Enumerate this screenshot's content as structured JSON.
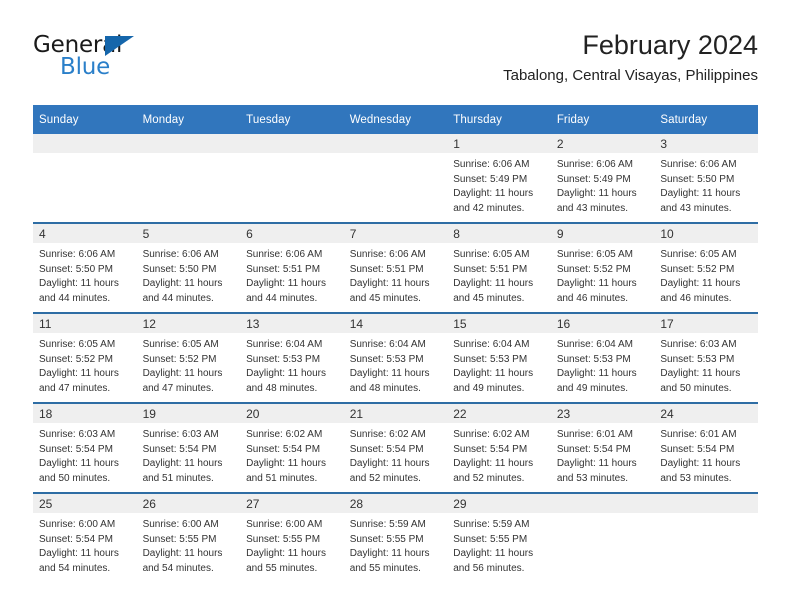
{
  "brand": {
    "word_one": "General",
    "word_two": "Blue",
    "logo_icon": "blue-triangle-icon"
  },
  "header": {
    "title": "February 2024",
    "location": "Tabalong, Central Visayas, Philippines"
  },
  "colors": {
    "header_blue": "#3176bd",
    "row_divider_blue": "#2e6da4",
    "daynum_strip_gray": "#efefef",
    "brand_blue": "#2a7fc9",
    "logo_triangle_blue": "#1566ab",
    "text": "#333333"
  },
  "weekday_headers": [
    "Sunday",
    "Monday",
    "Tuesday",
    "Wednesday",
    "Thursday",
    "Friday",
    "Saturday"
  ],
  "weeks": [
    [
      {
        "day": "",
        "empty": true
      },
      {
        "day": "",
        "empty": true
      },
      {
        "day": "",
        "empty": true
      },
      {
        "day": "",
        "empty": true
      },
      {
        "day": "1",
        "sunrise": "Sunrise: 6:06 AM",
        "sunset": "Sunset: 5:49 PM",
        "daylight": "Daylight: 11 hours and 42 minutes."
      },
      {
        "day": "2",
        "sunrise": "Sunrise: 6:06 AM",
        "sunset": "Sunset: 5:49 PM",
        "daylight": "Daylight: 11 hours and 43 minutes."
      },
      {
        "day": "3",
        "sunrise": "Sunrise: 6:06 AM",
        "sunset": "Sunset: 5:50 PM",
        "daylight": "Daylight: 11 hours and 43 minutes."
      }
    ],
    [
      {
        "day": "4",
        "sunrise": "Sunrise: 6:06 AM",
        "sunset": "Sunset: 5:50 PM",
        "daylight": "Daylight: 11 hours and 44 minutes."
      },
      {
        "day": "5",
        "sunrise": "Sunrise: 6:06 AM",
        "sunset": "Sunset: 5:50 PM",
        "daylight": "Daylight: 11 hours and 44 minutes."
      },
      {
        "day": "6",
        "sunrise": "Sunrise: 6:06 AM",
        "sunset": "Sunset: 5:51 PM",
        "daylight": "Daylight: 11 hours and 44 minutes."
      },
      {
        "day": "7",
        "sunrise": "Sunrise: 6:06 AM",
        "sunset": "Sunset: 5:51 PM",
        "daylight": "Daylight: 11 hours and 45 minutes."
      },
      {
        "day": "8",
        "sunrise": "Sunrise: 6:05 AM",
        "sunset": "Sunset: 5:51 PM",
        "daylight": "Daylight: 11 hours and 45 minutes."
      },
      {
        "day": "9",
        "sunrise": "Sunrise: 6:05 AM",
        "sunset": "Sunset: 5:52 PM",
        "daylight": "Daylight: 11 hours and 46 minutes."
      },
      {
        "day": "10",
        "sunrise": "Sunrise: 6:05 AM",
        "sunset": "Sunset: 5:52 PM",
        "daylight": "Daylight: 11 hours and 46 minutes."
      }
    ],
    [
      {
        "day": "11",
        "sunrise": "Sunrise: 6:05 AM",
        "sunset": "Sunset: 5:52 PM",
        "daylight": "Daylight: 11 hours and 47 minutes."
      },
      {
        "day": "12",
        "sunrise": "Sunrise: 6:05 AM",
        "sunset": "Sunset: 5:52 PM",
        "daylight": "Daylight: 11 hours and 47 minutes."
      },
      {
        "day": "13",
        "sunrise": "Sunrise: 6:04 AM",
        "sunset": "Sunset: 5:53 PM",
        "daylight": "Daylight: 11 hours and 48 minutes."
      },
      {
        "day": "14",
        "sunrise": "Sunrise: 6:04 AM",
        "sunset": "Sunset: 5:53 PM",
        "daylight": "Daylight: 11 hours and 48 minutes."
      },
      {
        "day": "15",
        "sunrise": "Sunrise: 6:04 AM",
        "sunset": "Sunset: 5:53 PM",
        "daylight": "Daylight: 11 hours and 49 minutes."
      },
      {
        "day": "16",
        "sunrise": "Sunrise: 6:04 AM",
        "sunset": "Sunset: 5:53 PM",
        "daylight": "Daylight: 11 hours and 49 minutes."
      },
      {
        "day": "17",
        "sunrise": "Sunrise: 6:03 AM",
        "sunset": "Sunset: 5:53 PM",
        "daylight": "Daylight: 11 hours and 50 minutes."
      }
    ],
    [
      {
        "day": "18",
        "sunrise": "Sunrise: 6:03 AM",
        "sunset": "Sunset: 5:54 PM",
        "daylight": "Daylight: 11 hours and 50 minutes."
      },
      {
        "day": "19",
        "sunrise": "Sunrise: 6:03 AM",
        "sunset": "Sunset: 5:54 PM",
        "daylight": "Daylight: 11 hours and 51 minutes."
      },
      {
        "day": "20",
        "sunrise": "Sunrise: 6:02 AM",
        "sunset": "Sunset: 5:54 PM",
        "daylight": "Daylight: 11 hours and 51 minutes."
      },
      {
        "day": "21",
        "sunrise": "Sunrise: 6:02 AM",
        "sunset": "Sunset: 5:54 PM",
        "daylight": "Daylight: 11 hours and 52 minutes."
      },
      {
        "day": "22",
        "sunrise": "Sunrise: 6:02 AM",
        "sunset": "Sunset: 5:54 PM",
        "daylight": "Daylight: 11 hours and 52 minutes."
      },
      {
        "day": "23",
        "sunrise": "Sunrise: 6:01 AM",
        "sunset": "Sunset: 5:54 PM",
        "daylight": "Daylight: 11 hours and 53 minutes."
      },
      {
        "day": "24",
        "sunrise": "Sunrise: 6:01 AM",
        "sunset": "Sunset: 5:54 PM",
        "daylight": "Daylight: 11 hours and 53 minutes."
      }
    ],
    [
      {
        "day": "25",
        "sunrise": "Sunrise: 6:00 AM",
        "sunset": "Sunset: 5:54 PM",
        "daylight": "Daylight: 11 hours and 54 minutes."
      },
      {
        "day": "26",
        "sunrise": "Sunrise: 6:00 AM",
        "sunset": "Sunset: 5:55 PM",
        "daylight": "Daylight: 11 hours and 54 minutes."
      },
      {
        "day": "27",
        "sunrise": "Sunrise: 6:00 AM",
        "sunset": "Sunset: 5:55 PM",
        "daylight": "Daylight: 11 hours and 55 minutes."
      },
      {
        "day": "28",
        "sunrise": "Sunrise: 5:59 AM",
        "sunset": "Sunset: 5:55 PM",
        "daylight": "Daylight: 11 hours and 55 minutes."
      },
      {
        "day": "29",
        "sunrise": "Sunrise: 5:59 AM",
        "sunset": "Sunset: 5:55 PM",
        "daylight": "Daylight: 11 hours and 56 minutes."
      },
      {
        "day": "",
        "empty": true
      },
      {
        "day": "",
        "empty": true
      }
    ]
  ]
}
